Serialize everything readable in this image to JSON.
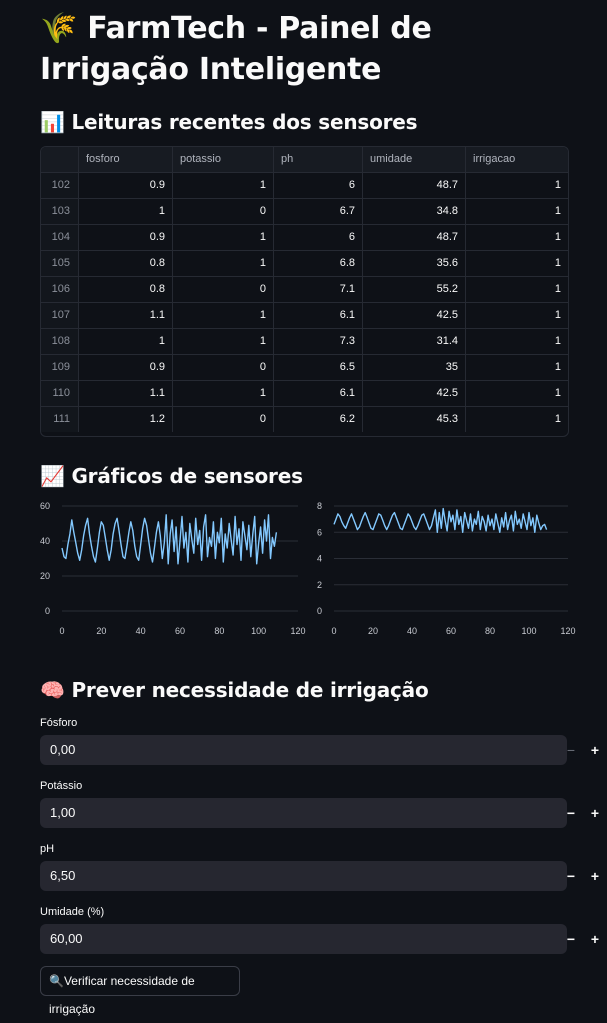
{
  "header": {
    "icon": "🌾",
    "title": "FarmTech - Painel de Irrigação Inteligente"
  },
  "readings": {
    "icon": "📊",
    "heading": "Leituras recentes dos sensores",
    "columns": [
      "fosforo",
      "potassio",
      "ph",
      "umidade",
      "irrigacao"
    ],
    "rows": [
      {
        "index": "102",
        "cells": [
          "0.9",
          "1",
          "6",
          "48.7",
          "1"
        ]
      },
      {
        "index": "103",
        "cells": [
          "1",
          "0",
          "6.7",
          "34.8",
          "1"
        ]
      },
      {
        "index": "104",
        "cells": [
          "0.9",
          "1",
          "6",
          "48.7",
          "1"
        ]
      },
      {
        "index": "105",
        "cells": [
          "0.8",
          "1",
          "6.8",
          "35.6",
          "1"
        ]
      },
      {
        "index": "106",
        "cells": [
          "0.8",
          "0",
          "7.1",
          "55.2",
          "1"
        ]
      },
      {
        "index": "107",
        "cells": [
          "1.1",
          "1",
          "6.1",
          "42.5",
          "1"
        ]
      },
      {
        "index": "108",
        "cells": [
          "1",
          "1",
          "7.3",
          "31.4",
          "1"
        ]
      },
      {
        "index": "109",
        "cells": [
          "0.9",
          "0",
          "6.5",
          "35",
          "1"
        ]
      },
      {
        "index": "110",
        "cells": [
          "1.1",
          "1",
          "6.1",
          "42.5",
          "1"
        ]
      },
      {
        "index": "111",
        "cells": [
          "1.2",
          "0",
          "6.2",
          "45.3",
          "1"
        ]
      }
    ]
  },
  "charts": {
    "icon": "📈",
    "heading": "Gráficos de sensores",
    "line_color": "#83c9ff"
  },
  "chart_data": [
    {
      "type": "line",
      "series": [
        {
          "values": [
            36,
            31,
            30,
            38,
            44,
            52,
            45,
            39,
            33,
            29,
            35,
            43,
            49,
            53,
            44,
            37,
            31,
            28,
            36,
            45,
            51,
            49,
            42,
            35,
            29,
            35,
            44,
            50,
            53,
            46,
            38,
            31,
            30,
            37,
            45,
            51,
            46,
            37,
            31,
            29,
            38,
            47,
            53,
            49,
            41,
            33,
            28,
            36,
            45,
            51,
            43,
            30,
            39,
            55,
            27,
            44,
            52,
            34,
            48,
            27,
            40,
            54,
            36,
            45,
            28,
            50,
            41,
            33,
            53,
            38,
            46,
            29,
            48,
            55,
            31,
            42,
            37,
            51,
            30,
            45,
            39,
            53,
            28,
            44,
            36,
            50,
            41,
            32,
            54,
            38,
            47,
            29,
            51,
            43,
            35,
            49,
            31,
            44,
            54,
            27,
            39,
            48,
            33,
            52,
            40,
            55,
            30,
            42,
            37,
            45
          ]
        }
      ],
      "x_ticks": [
        0,
        20,
        40,
        60,
        80,
        100,
        120
      ],
      "y_ticks": [
        0,
        20,
        40,
        60
      ],
      "xlim": [
        0,
        120
      ],
      "ylim": [
        0,
        60
      ]
    },
    {
      "type": "line",
      "series": [
        {
          "values": [
            6.6,
            7.0,
            7.4,
            7.2,
            6.8,
            6.5,
            6.3,
            6.7,
            7.1,
            7.4,
            7.0,
            6.6,
            6.2,
            6.4,
            6.8,
            7.2,
            7.5,
            7.1,
            6.7,
            6.3,
            6.2,
            6.6,
            7.0,
            7.4,
            7.3,
            6.9,
            6.5,
            6.2,
            6.5,
            6.9,
            7.3,
            7.5,
            7.1,
            6.7,
            6.3,
            6.2,
            6.6,
            7.0,
            7.4,
            7.2,
            6.8,
            6.4,
            6.2,
            6.5,
            6.9,
            7.3,
            7.4,
            7.0,
            6.6,
            6.2,
            6.5,
            7.1,
            7.7,
            6.0,
            7.5,
            6.3,
            7.8,
            6.9,
            6.1,
            7.6,
            6.8,
            7.3,
            6.2,
            7.7,
            6.6,
            7.2,
            6.0,
            7.5,
            6.9,
            6.3,
            7.4,
            6.1,
            7.0,
            6.6,
            7.6,
            6.2,
            7.2,
            6.8,
            6.1,
            7.3,
            6.5,
            7.0,
            6.2,
            7.4,
            6.7,
            6.0,
            7.1,
            6.4,
            7.5,
            6.2,
            6.9,
            7.3,
            6.1,
            7.6,
            6.6,
            7.0,
            6.3,
            7.4,
            6.8,
            6.2,
            7.5,
            6.5,
            7.1,
            6.0,
            7.3,
            6.7,
            6.2,
            6.5,
            6.6,
            6.2
          ]
        }
      ],
      "x_ticks": [
        0,
        20,
        40,
        60,
        80,
        100,
        120
      ],
      "y_ticks": [
        0,
        2,
        4,
        6,
        8
      ],
      "xlim": [
        0,
        120
      ],
      "ylim": [
        0,
        8
      ]
    }
  ],
  "predict": {
    "icon": "🧠",
    "heading": "Prever necessidade de irrigação",
    "fields": [
      {
        "label": "Fósforo",
        "value": "0,00",
        "minus": "−",
        "plus": "+"
      },
      {
        "label": "Potássio",
        "value": "1,00",
        "minus": "−",
        "plus": "+"
      },
      {
        "label": "pH",
        "value": "6,50",
        "minus": "−",
        "plus": "+"
      },
      {
        "label": "Umidade (%)",
        "value": "60,00",
        "minus": "−",
        "plus": "+"
      }
    ],
    "button_icon": "🔍",
    "button_label": "Verificar necessidade de irrigação"
  }
}
